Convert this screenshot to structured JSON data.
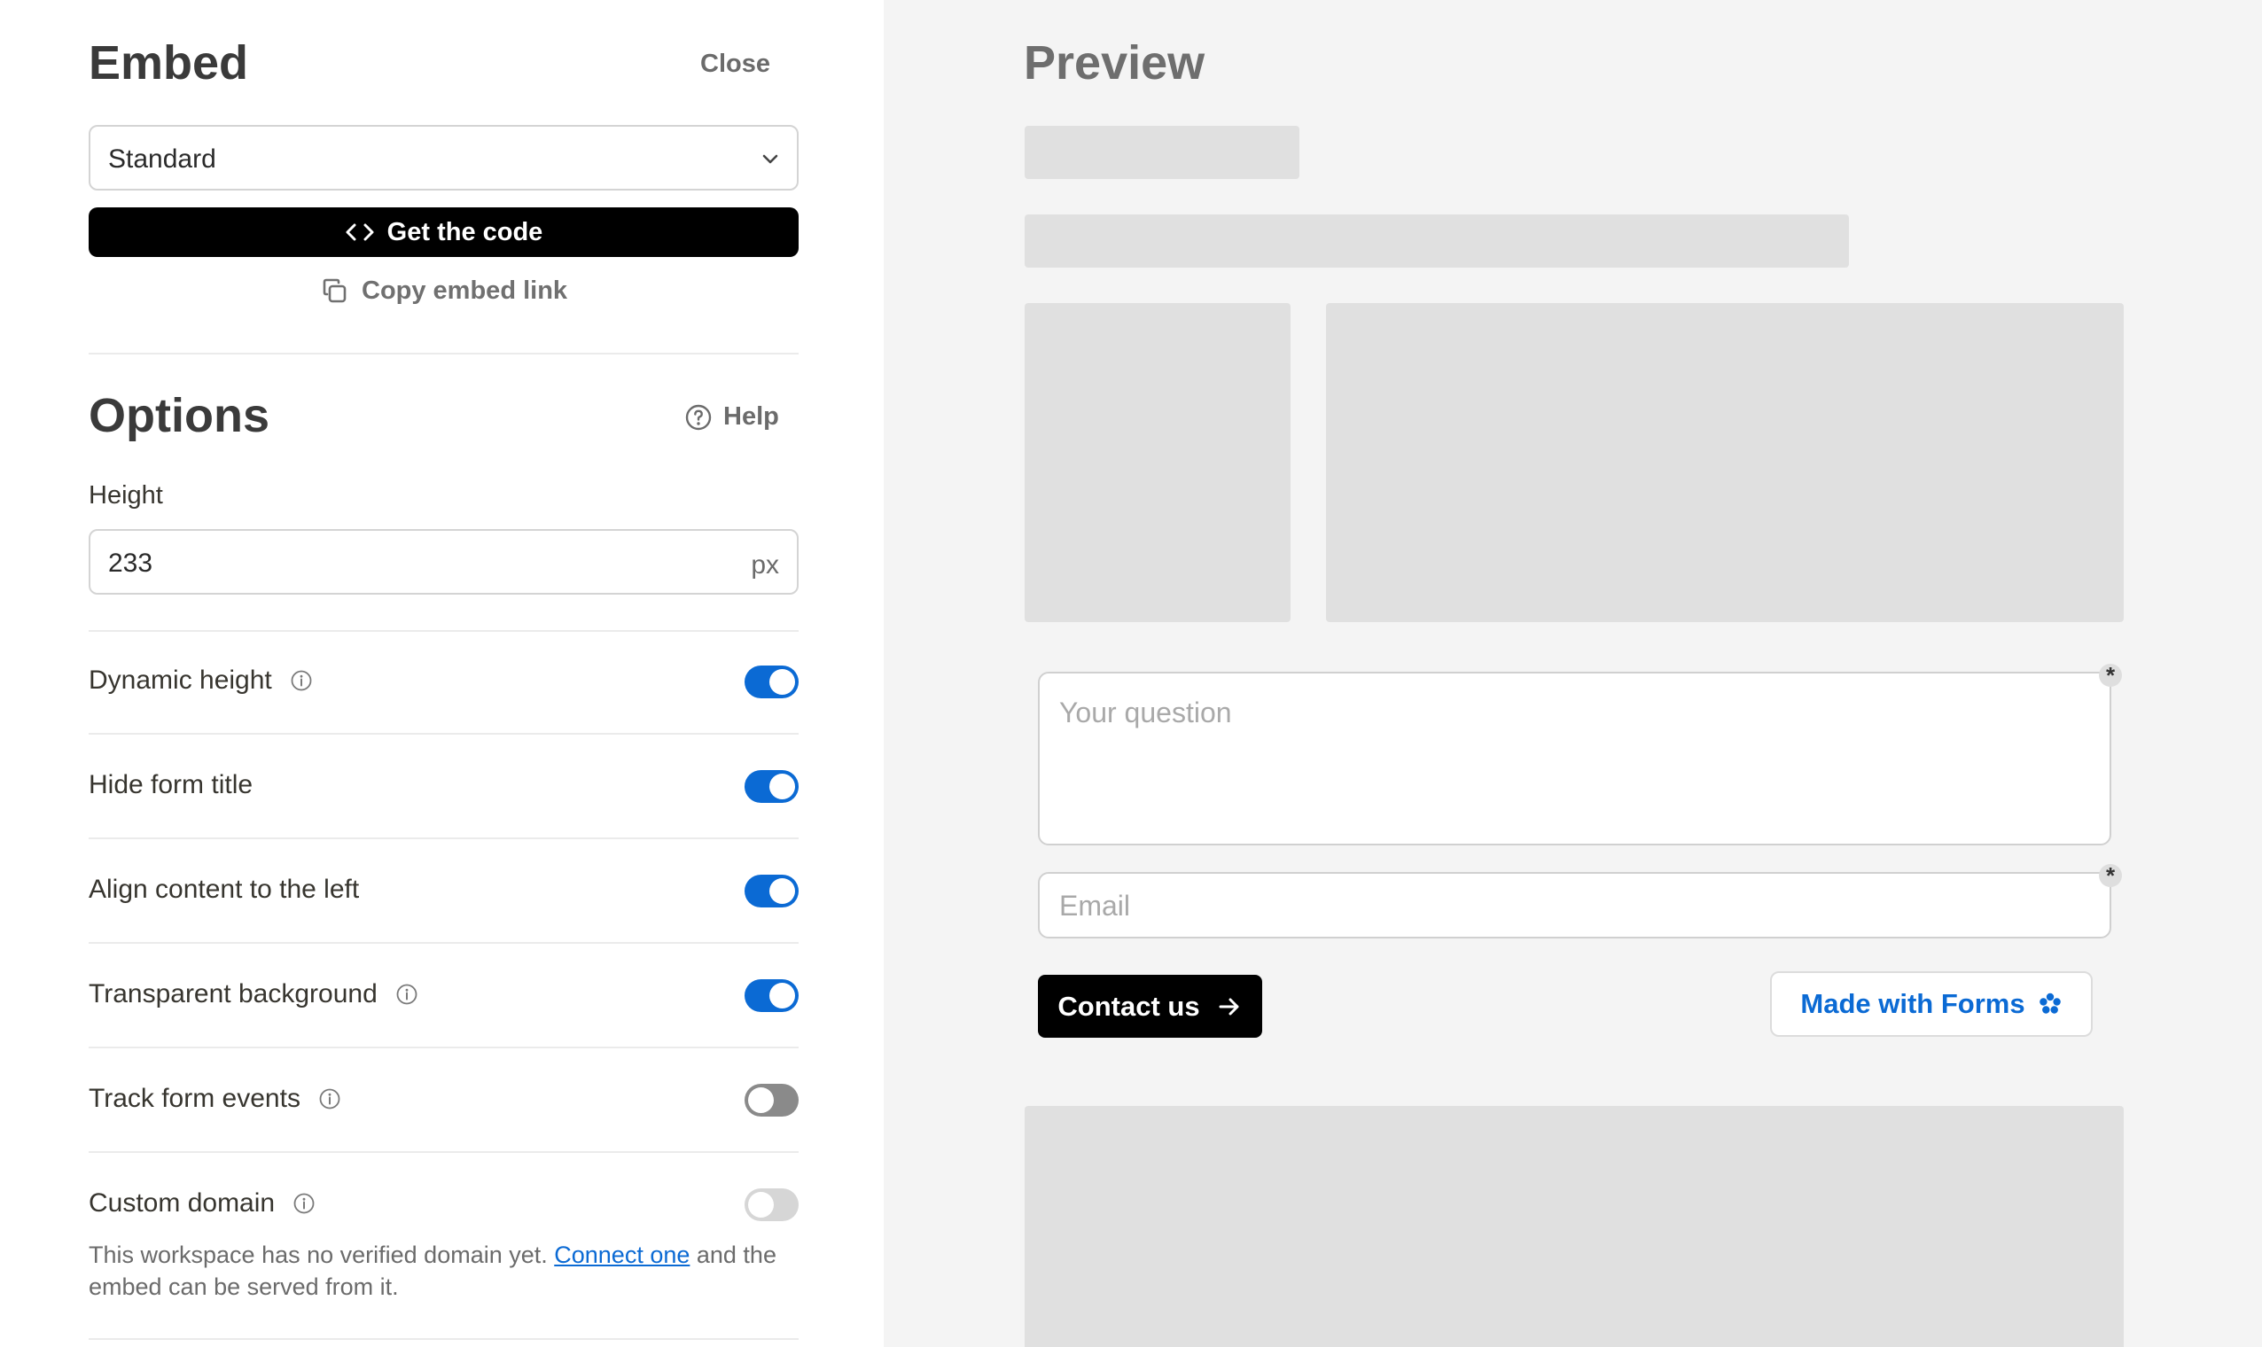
{
  "embed": {
    "title": "Embed",
    "close_label": "Close",
    "mode_select": {
      "value": "Standard"
    },
    "get_code_label": "Get the code",
    "copy_link_label": "Copy embed link"
  },
  "options": {
    "title": "Options",
    "help_label": "Help",
    "height": {
      "label": "Height",
      "value": "233",
      "unit": "px"
    },
    "toggles": [
      {
        "label": "Dynamic height",
        "info": true,
        "state": "on"
      },
      {
        "label": "Hide form title",
        "info": false,
        "state": "on"
      },
      {
        "label": "Align content to the left",
        "info": false,
        "state": "on"
      },
      {
        "label": "Transparent background",
        "info": true,
        "state": "on"
      },
      {
        "label": "Track form events",
        "info": true,
        "state": "off"
      },
      {
        "label": "Custom domain",
        "info": true,
        "state": "disabled"
      }
    ],
    "custom_domain_note": {
      "before": "This workspace has no verified domain yet. ",
      "link": "Connect one",
      "after": " and the embed can be served from it."
    }
  },
  "preview": {
    "title": "Preview",
    "question_placeholder": "Your question",
    "email_placeholder": "Email",
    "required_mark": "*",
    "submit_label": "Contact us",
    "badge_label": "Made with Forms"
  },
  "colors": {
    "accent": "#0b6ad4",
    "toggle_off": "#8a8a8a",
    "toggle_disabled": "#d6d6d6",
    "preview_bg": "#f4f4f4",
    "placeholder_block": "#e0e0e0"
  }
}
